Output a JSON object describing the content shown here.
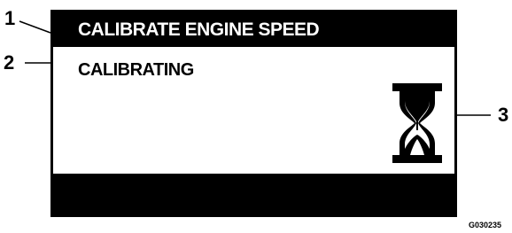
{
  "screen": {
    "title": "CALIBRATE ENGINE SPEED",
    "status": "CALIBRATING",
    "icon": "hourglass-icon"
  },
  "callouts": [
    "1",
    "2",
    "3"
  ],
  "figure_id": "G030235",
  "colors": {
    "screen_background": "#000000",
    "content_background": "#ffffff",
    "title_text": "#ffffff",
    "body_text": "#000000"
  }
}
